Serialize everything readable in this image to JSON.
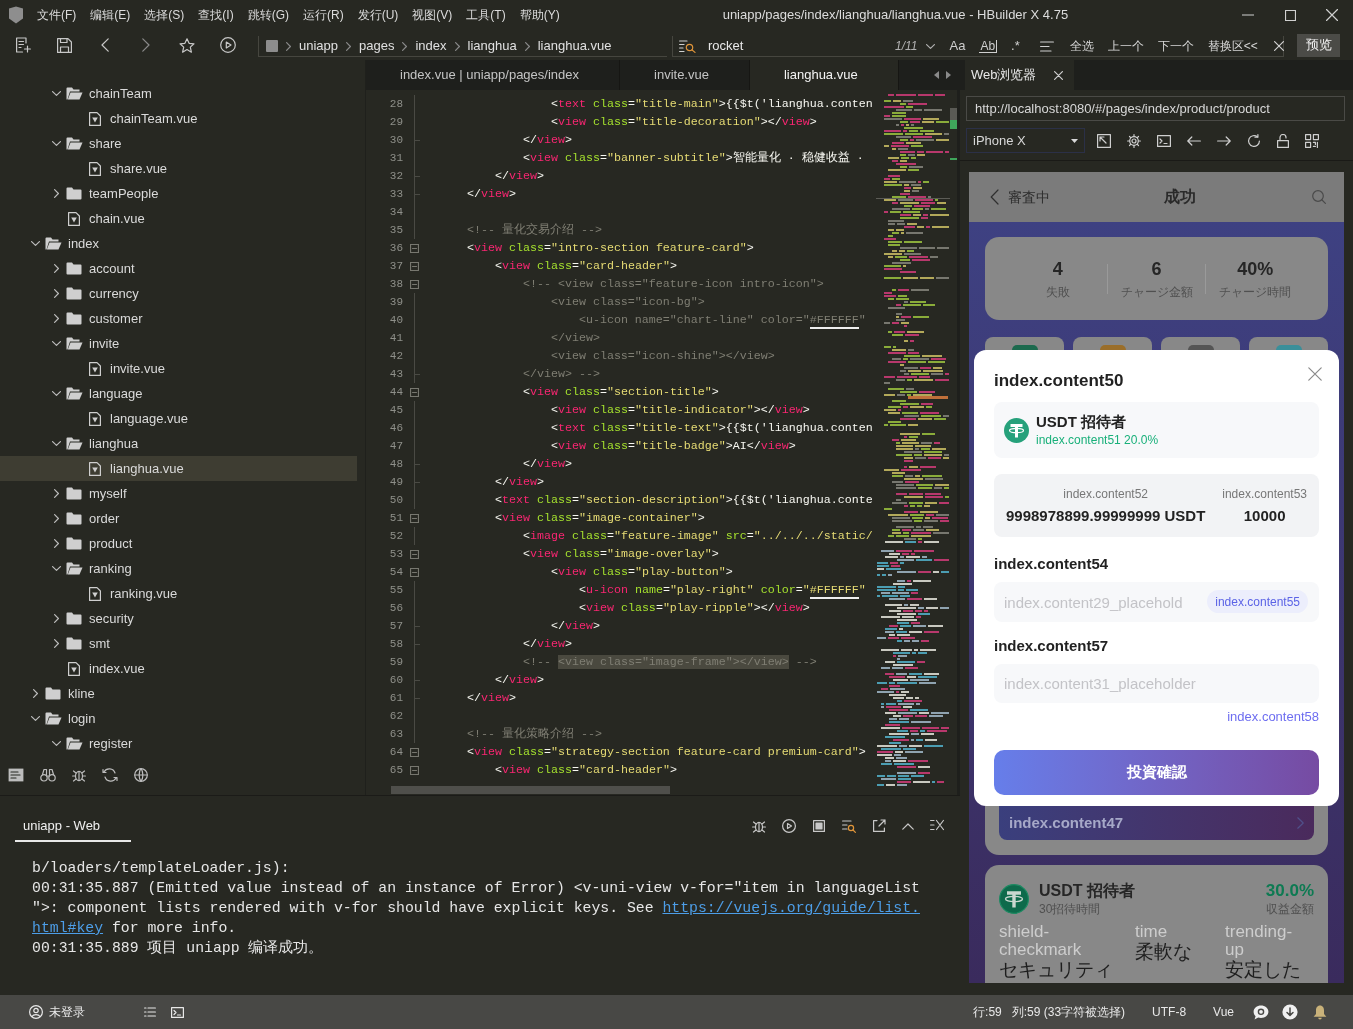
{
  "window": {
    "title": "uniapp/pages/index/lianghua/lianghua.vue - HBuilder X 4.75"
  },
  "menu": [
    "文件(F)",
    "编辑(E)",
    "选择(S)",
    "查找(I)",
    "跳转(G)",
    "运行(R)",
    "发行(U)",
    "视图(V)",
    "工具(T)",
    "帮助(Y)"
  ],
  "toolbar": {
    "breadcrumb": [
      "uniapp",
      "pages",
      "index",
      "lianghua",
      "lianghua.vue"
    ],
    "find": {
      "query": "rocket",
      "match_count": "1/11",
      "options": [
        {
          "label": "Aa",
          "kind": "text"
        },
        {
          "label": "Ab",
          "kind": "boxed"
        },
        {
          "label": ".*",
          "kind": "text"
        }
      ],
      "actions": [
        "全选",
        "上一个",
        "下一个",
        "替换区<<"
      ]
    },
    "preview_button": "预览"
  },
  "sidebar": {
    "tree": [
      {
        "kind": "partial",
        "children": [
          {
            "kind": "folder",
            "label": "chainTeam",
            "expanded": true,
            "selected": false,
            "children": [
              {
                "kind": "file",
                "label": "chainTeam.vue",
                "selected": false
              }
            ]
          },
          {
            "kind": "folder",
            "label": "share",
            "expanded": true,
            "selected": false,
            "children": [
              {
                "kind": "file",
                "label": "share.vue",
                "selected": false
              }
            ]
          },
          {
            "kind": "folder",
            "label": "teamPeople",
            "expanded": false,
            "selected": false
          },
          {
            "kind": "file",
            "label": "chain.vue",
            "selected": false
          }
        ]
      },
      {
        "kind": "folder",
        "label": "index",
        "expanded": true,
        "selected": false,
        "children": [
          {
            "kind": "folder",
            "label": "account",
            "expanded": false,
            "selected": false
          },
          {
            "kind": "folder",
            "label": "currency",
            "expanded": false,
            "selected": false
          },
          {
            "kind": "folder",
            "label": "customer",
            "expanded": false,
            "selected": false
          },
          {
            "kind": "folder",
            "label": "invite",
            "expanded": true,
            "selected": false,
            "children": [
              {
                "kind": "file",
                "label": "invite.vue",
                "selected": false
              }
            ]
          },
          {
            "kind": "folder",
            "label": "language",
            "expanded": true,
            "selected": false,
            "children": [
              {
                "kind": "file",
                "label": "language.vue",
                "selected": false
              }
            ]
          },
          {
            "kind": "folder",
            "label": "lianghua",
            "expanded": true,
            "selected": false,
            "children": [
              {
                "kind": "file",
                "label": "lianghua.vue",
                "selected": true
              }
            ]
          },
          {
            "kind": "folder",
            "label": "myself",
            "expanded": false,
            "selected": false
          },
          {
            "kind": "folder",
            "label": "order",
            "expanded": false,
            "selected": false
          },
          {
            "kind": "folder",
            "label": "product",
            "expanded": false,
            "selected": false
          },
          {
            "kind": "folder",
            "label": "ranking",
            "expanded": true,
            "selected": false,
            "children": [
              {
                "kind": "file",
                "label": "ranking.vue",
                "selected": false
              }
            ]
          },
          {
            "kind": "folder",
            "label": "security",
            "expanded": false,
            "selected": false
          },
          {
            "kind": "folder",
            "label": "smt",
            "expanded": false,
            "selected": false
          },
          {
            "kind": "file",
            "label": "index.vue",
            "selected": false
          }
        ]
      },
      {
        "kind": "folder",
        "label": "kline",
        "expanded": false,
        "selected": false
      },
      {
        "kind": "folder",
        "label": "login",
        "expanded": true,
        "selected": false,
        "children": [
          {
            "kind": "folder",
            "label": "register",
            "expanded": true,
            "selected": false
          }
        ]
      }
    ]
  },
  "editor": {
    "tabs": [
      {
        "label": "index.vue | uniapp/pages/index",
        "selected": false
      },
      {
        "label": "invite.vue",
        "selected": false
      },
      {
        "label": "lianghua.vue",
        "selected": true
      }
    ],
    "lines": [
      {
        "number": "28",
        "foldable": false,
        "block_end": false,
        "kind": "code",
        "text": "                <text class=\"title-main\">{{$t('lianghua.conten"
      },
      {
        "number": "29",
        "foldable": false,
        "block_end": false,
        "kind": "code",
        "text": "                <view class=\"title-decoration\"></view>"
      },
      {
        "number": "30",
        "foldable": false,
        "block_end": true,
        "kind": "code",
        "text": "            </view>"
      },
      {
        "number": "31",
        "foldable": false,
        "block_end": false,
        "kind": "code",
        "text": "            <view class=\"banner-subtitle\">智能量化 · 稳健收益 ·"
      },
      {
        "number": "32",
        "foldable": false,
        "block_end": true,
        "kind": "code",
        "text": "        </view>"
      },
      {
        "number": "33",
        "foldable": false,
        "block_end": true,
        "kind": "code",
        "text": "    </view>"
      },
      {
        "number": "34",
        "foldable": false,
        "block_end": false
      },
      {
        "number": "35",
        "foldable": false,
        "block_end": false,
        "kind": "comment",
        "text": "    <!-- 量化交易介绍 -->"
      },
      {
        "number": "36",
        "foldable": true,
        "block_end": false,
        "kind": "code",
        "text": "    <view class=\"intro-section feature-card\">"
      },
      {
        "number": "37",
        "foldable": true,
        "block_end": false,
        "kind": "code",
        "text": "        <view class=\"card-header\">"
      },
      {
        "number": "38",
        "foldable": true,
        "block_end": false,
        "kind": "comment",
        "text": "            <!-- <view class=\"feature-icon intro-icon\">"
      },
      {
        "number": "39",
        "foldable": false,
        "block_end": false,
        "kind": "comment",
        "text": "                <view class=\"icon-bg\">"
      },
      {
        "number": "40",
        "foldable": false,
        "block_end": false,
        "kind": "comment",
        "text": "                    <u-icon name=\"chart-line\" color=\"#FFFFFF\""
      },
      {
        "number": "41",
        "foldable": false,
        "block_end": false,
        "kind": "comment",
        "text": "                </view>"
      },
      {
        "number": "42",
        "foldable": false,
        "block_end": false,
        "kind": "comment",
        "text": "                <view class=\"icon-shine\"></view>"
      },
      {
        "number": "43",
        "foldable": false,
        "block_end": true,
        "kind": "comment",
        "text": "            </view> -->"
      },
      {
        "number": "44",
        "foldable": true,
        "block_end": false,
        "kind": "code",
        "text": "            <view class=\"section-title\">"
      },
      {
        "number": "45",
        "foldable": false,
        "block_end": false,
        "kind": "code",
        "text": "                <view class=\"title-indicator\"></view>"
      },
      {
        "number": "46",
        "foldable": false,
        "block_end": false,
        "kind": "code",
        "text": "                <text class=\"title-text\">{{$t('lianghua.conten"
      },
      {
        "number": "47",
        "foldable": false,
        "block_end": false,
        "kind": "code",
        "text": "                <view class=\"title-badge\">AI</view>"
      },
      {
        "number": "48",
        "foldable": false,
        "block_end": true,
        "kind": "code",
        "text": "            </view>"
      },
      {
        "number": "49",
        "foldable": false,
        "block_end": true,
        "kind": "code",
        "text": "        </view>"
      },
      {
        "number": "50",
        "foldable": false,
        "block_end": false,
        "kind": "code",
        "text": "        <text class=\"section-description\">{{$t('lianghua.conte"
      },
      {
        "number": "51",
        "foldable": true,
        "block_end": false,
        "kind": "code",
        "text": "        <view class=\"image-container\">"
      },
      {
        "number": "52",
        "foldable": false,
        "block_end": false,
        "kind": "code",
        "text": "            <image class=\"feature-image\" src=\"../../../static/"
      },
      {
        "number": "53",
        "foldable": true,
        "block_end": false,
        "kind": "code",
        "text": "            <view class=\"image-overlay\">"
      },
      {
        "number": "54",
        "foldable": true,
        "block_end": false,
        "kind": "code",
        "text": "                <view class=\"play-button\">"
      },
      {
        "number": "55",
        "foldable": false,
        "block_end": false,
        "kind": "code",
        "text": "                    <u-icon name=\"play-right\" color=\"#FFFFFF\""
      },
      {
        "number": "56",
        "foldable": false,
        "block_end": false,
        "kind": "code",
        "text": "                    <view class=\"play-ripple\"></view>"
      },
      {
        "number": "57",
        "foldable": false,
        "block_end": true,
        "kind": "code",
        "text": "                </view>"
      },
      {
        "number": "58",
        "foldable": false,
        "block_end": true,
        "kind": "code",
        "text": "            </view>"
      },
      {
        "number": "59",
        "foldable": false,
        "block_end": false,
        "kind": "comment",
        "segments": [
          {
            "text": "            <!-- ",
            "selected": false
          },
          {
            "text": "<view class=\"image-frame\"></view>",
            "selected": true
          },
          {
            "text": " -->",
            "selected": false
          }
        ]
      },
      {
        "number": "60",
        "foldable": false,
        "block_end": true,
        "kind": "code",
        "text": "        </view>"
      },
      {
        "number": "61",
        "foldable": false,
        "block_end": true,
        "kind": "code",
        "text": "    </view>"
      },
      {
        "number": "62",
        "foldable": false,
        "block_end": false
      },
      {
        "number": "63",
        "foldable": false,
        "block_end": false,
        "kind": "comment",
        "text": "    <!-- 量化策略介绍 -->"
      },
      {
        "number": "64",
        "foldable": true,
        "block_end": false,
        "kind": "code",
        "text": "    <view class=\"strategy-section feature-card premium-card\">"
      },
      {
        "number": "65",
        "foldable": true,
        "block_end": false,
        "kind": "code",
        "text": "        <view class=\"card-header\">"
      }
    ]
  },
  "console": {
    "tabs": [
      {
        "label": "uniapp - Web",
        "selected": true
      }
    ],
    "lines": [
      {
        "segments": [
          {
            "kind": "text",
            "text": "b/loaders/templateLoader.js):"
          }
        ]
      },
      {
        "segments": [
          {
            "kind": "text",
            "text": "00:31:35.887 (Emitted value instead of an instance of Error) <v-uni-view v-for=\"item in languageList"
          }
        ]
      },
      {
        "segments": [
          {
            "kind": "text",
            "text": "\">: component lists rendered with v-for should have explicit keys. See "
          },
          {
            "kind": "link",
            "text": "https://vuejs.org/guide/list."
          }
        ]
      },
      {
        "segments": [
          {
            "kind": "link",
            "text": "html#key"
          },
          {
            "kind": "text",
            "text": " for more info."
          }
        ]
      },
      {
        "segments": [
          {
            "kind": "text",
            "text": "00:31:35.889 项目 uniapp 编译成功。"
          }
        ]
      }
    ]
  },
  "browser": {
    "tabs": [
      {
        "label": "Web浏览器",
        "selected": true
      }
    ],
    "url": "http://localhost:8080/#/pages/index/product/product",
    "device": "iPhone X",
    "page": {
      "header": {
        "back_label": "審査中",
        "title": "成功"
      },
      "stats": [
        {
          "value": "4",
          "label": "失敗"
        },
        {
          "value": "6",
          "label": "チャージ金額"
        },
        {
          "value": "40%",
          "label": "チャージ時間"
        }
      ],
      "asset_cards": [
        {
          "color": "#1c6a4e"
        },
        {
          "color": "#9a6e2a"
        },
        {
          "color": "#555555"
        },
        {
          "color": "#3a8f9a"
        }
      ],
      "modal": {
        "title": "index.content50",
        "product": {
          "name": "USDT 招待者",
          "rate": "index.content51 20.0%"
        },
        "balance": {
          "label": "index.content52",
          "value": "9998978899.99999999 USDT"
        },
        "limit": {
          "label": "index.content53",
          "value": "10000"
        },
        "amount": {
          "label": "index.content54",
          "placeholder": "index.content29_placehold",
          "badge": "index.content55"
        },
        "password": {
          "label": "index.content57",
          "placeholder": "index.content31_placeholder"
        },
        "link": "index.content58",
        "button": "投資確認"
      },
      "banner": "index.content47",
      "product_card": {
        "name": "USDT 招待者",
        "period": "30招待時間",
        "rate": "30.0%",
        "rate_label": "収益金額",
        "features": [
          {
            "icon_text": "shield-checkmark",
            "label": "セキュリティ"
          },
          {
            "icon_text": "time",
            "label": "柔軟な"
          },
          {
            "icon_text": "trending-up",
            "label": "安定した"
          }
        ]
      }
    }
  },
  "status_bar": {
    "user": "未登录",
    "line": "行:59",
    "column": "列:59 (33字符被选择)",
    "encoding": "UTF-8",
    "language": "Vue"
  }
}
